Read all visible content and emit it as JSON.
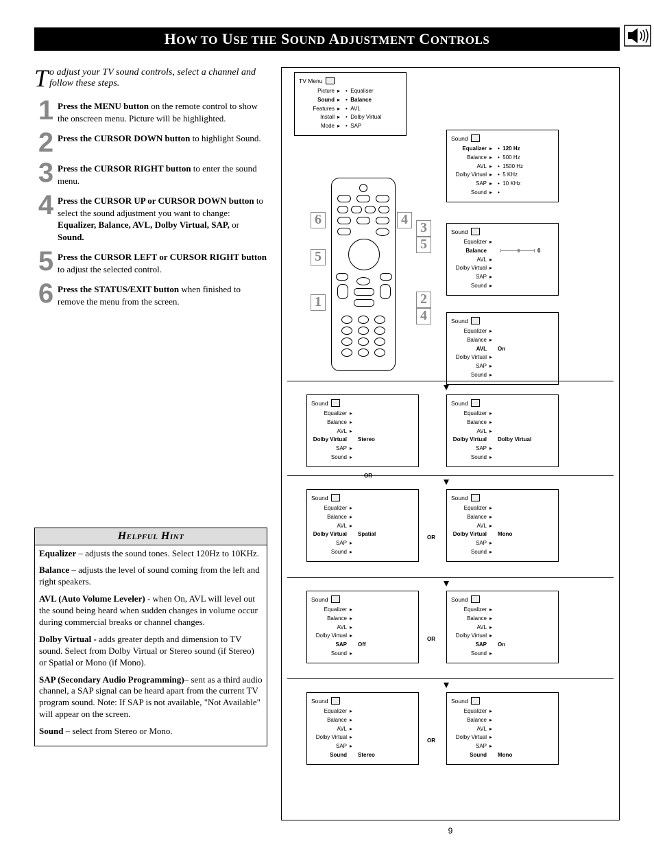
{
  "title_html": "H<span style='font-size:17px'>OW TO</span> U<span style='font-size:17px'>SE THE</span> S<span style='font-size:17px'>OUND</span> A<span style='font-size:17px'>DJUSTMENT</span> C<span style='font-size:17px'>ONTROLS</span>",
  "intro": "o adjust your TV sound controls, select a channel and follow these steps.",
  "intro_dropcap": "T",
  "steps": [
    {
      "n": "1",
      "b": "Press the MENU button",
      "t": " on the remote control to show the onscreen menu. Picture will be highlighted."
    },
    {
      "n": "2",
      "b": "Press the CURSOR DOWN  button",
      "t": " to highlight Sound."
    },
    {
      "n": "3",
      "b": "Press the CURSOR RIGHT button",
      "t": " to enter the sound menu."
    },
    {
      "n": "4",
      "b": "Press the CURSOR UP or CURSOR DOWN button",
      "t": " to select the sound adjustment you want to change:  ",
      "b2": "Equalizer, Balance, AVL, Dolby Virtual, SAP,",
      "t2": " or ",
      "b3": "Sound."
    },
    {
      "n": "5",
      "b": "Press the CURSOR LEFT or CURSOR RIGHT button",
      "t": " to adjust the selected control."
    },
    {
      "n": "6",
      "b": "Press the STATUS/EXIT button",
      "t": " when finished to remove the menu from the screen."
    }
  ],
  "hint_title": "Helpful Hint",
  "hints": [
    {
      "b": "Equalizer",
      "t": " – adjusts the sound tones. Select 120Hz  to 10KHz."
    },
    {
      "b": "Balance",
      "t": " – adjusts the level of sound coming from the left and right speakers."
    },
    {
      "b": "AVL (Auto Volume Leveler)",
      "t": " - when On, AVL will level out the sound being heard when sudden changes in volume occur during commercial breaks or channel changes."
    },
    {
      "b": "Dolby Virtual -",
      "t": " adds greater depth and dimension to TV sound. Select from Dolby Virtual or Stereo sound (if Stereo) or Spatial or Mono (if Mono)."
    },
    {
      "b": "SAP (Secondary Audio Programming)",
      "t": "– sent as a third audio channel, a SAP signal can be heard apart from the current TV program sound.  Note: If SAP is not available, \"Not Available\" will appear on the screen."
    },
    {
      "b": "Sound",
      "t": " – select from Stereo or Mono."
    }
  ],
  "tv_menu": {
    "title": "TV Menu",
    "items": [
      "Picture",
      "Sound",
      "Features",
      "Install",
      "Mode"
    ],
    "sel": "Sound",
    "right": [
      "Equaliser",
      "Balance",
      "AVL",
      "Dolby Virtual",
      "SAP"
    ]
  },
  "eq_menu": {
    "title": "Sound",
    "items": [
      "Equalizer",
      "Balance",
      "AVL",
      "Dolby Virtual",
      "SAP",
      "Sound"
    ],
    "sel": "Equalizer",
    "right": [
      "120 Hz",
      "500 Hz",
      "1500 Hz",
      "5 KHz",
      "10 KHz"
    ]
  },
  "bal_menu": {
    "title": "Sound",
    "items": [
      "Equalizer",
      "Balance",
      "AVL",
      "Dolby Virtual",
      "SAP",
      "Sound"
    ],
    "sel": "Balance",
    "val": "0"
  },
  "avl_menu": {
    "title": "Sound",
    "items": [
      "Equalizer",
      "Balance",
      "AVL",
      "Dolby Virtual",
      "SAP",
      "Sound"
    ],
    "sel": "AVL",
    "val": "On"
  },
  "dv_stereo": {
    "title": "Sound",
    "sel": "Dolby Virtual",
    "val": "Stereo"
  },
  "dv_dolby": {
    "title": "Sound",
    "sel": "Dolby Virtual",
    "val": "Dolby Virtual"
  },
  "dv_spatial": {
    "title": "Sound",
    "sel": "Dolby Virtual",
    "val": "Spatial"
  },
  "dv_mono": {
    "title": "Sound",
    "sel": "Dolby Virtual",
    "val": "Mono"
  },
  "sap_off": {
    "title": "Sound",
    "sel": "SAP",
    "val": "Off"
  },
  "sap_on": {
    "title": "Sound",
    "sel": "SAP",
    "val": "On"
  },
  "snd_stereo": {
    "title": "Sound",
    "sel": "Sound",
    "val": "Stereo"
  },
  "snd_mono": {
    "title": "Sound",
    "sel": "Sound",
    "val": "Mono"
  },
  "sound_items": [
    "Equalizer",
    "Balance",
    "AVL",
    "Dolby Virtual",
    "SAP",
    "Sound"
  ],
  "or": "OR",
  "page": "9",
  "callouts": [
    "1",
    "2",
    "3",
    "4",
    "5",
    "6"
  ]
}
